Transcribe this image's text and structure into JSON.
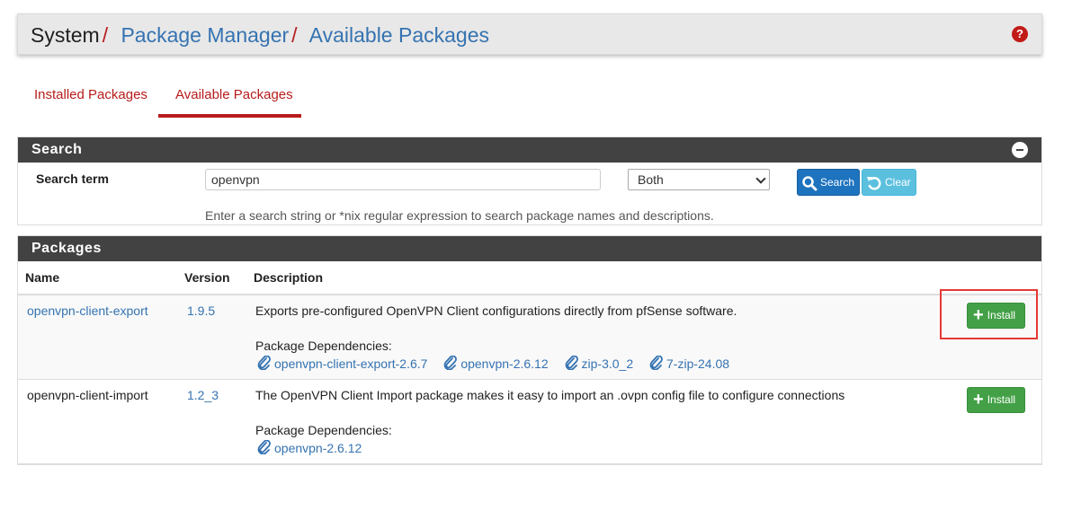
{
  "breadcrumb": {
    "root": "System",
    "separator": "/",
    "level2": "Package Manager",
    "level3": "Available Packages"
  },
  "help_icon": "?",
  "tabs": [
    {
      "label": "Installed Packages",
      "active": false
    },
    {
      "label": "Available Packages",
      "active": true
    }
  ],
  "search_panel": {
    "title": "Search",
    "label": "Search term",
    "input_value": "openvpn",
    "select_value": "Both",
    "search_button": "Search",
    "clear_button": "Clear",
    "help_text": "Enter a search string or *nix regular expression to search package names and descriptions."
  },
  "packages_panel": {
    "title": "Packages",
    "columns": [
      "Name",
      "Version",
      "Description"
    ],
    "dep_label": "Package Dependencies:",
    "install_label": "Install",
    "rows": [
      {
        "name": "openvpn-client-export",
        "version": "1.9.5",
        "description": "Exports pre-configured OpenVPN Client configurations directly from pfSense software.",
        "deps": [
          "openvpn-client-export-2.6.7",
          "openvpn-2.6.12",
          "zip-3.0_2",
          "7-zip-24.08"
        ]
      },
      {
        "name": "openvpn-client-import",
        "version": "1.2_3",
        "description": "The OpenVPN Client Import package makes it easy to import an .ovpn config file to configure connections",
        "deps": [
          "openvpn-2.6.12"
        ]
      }
    ]
  },
  "colors": {
    "accent_red": "#b71c1c",
    "link_blue": "#3573b1",
    "panel_header": "#424242",
    "install_green": "#43a047",
    "highlight_red": "#e53935"
  }
}
